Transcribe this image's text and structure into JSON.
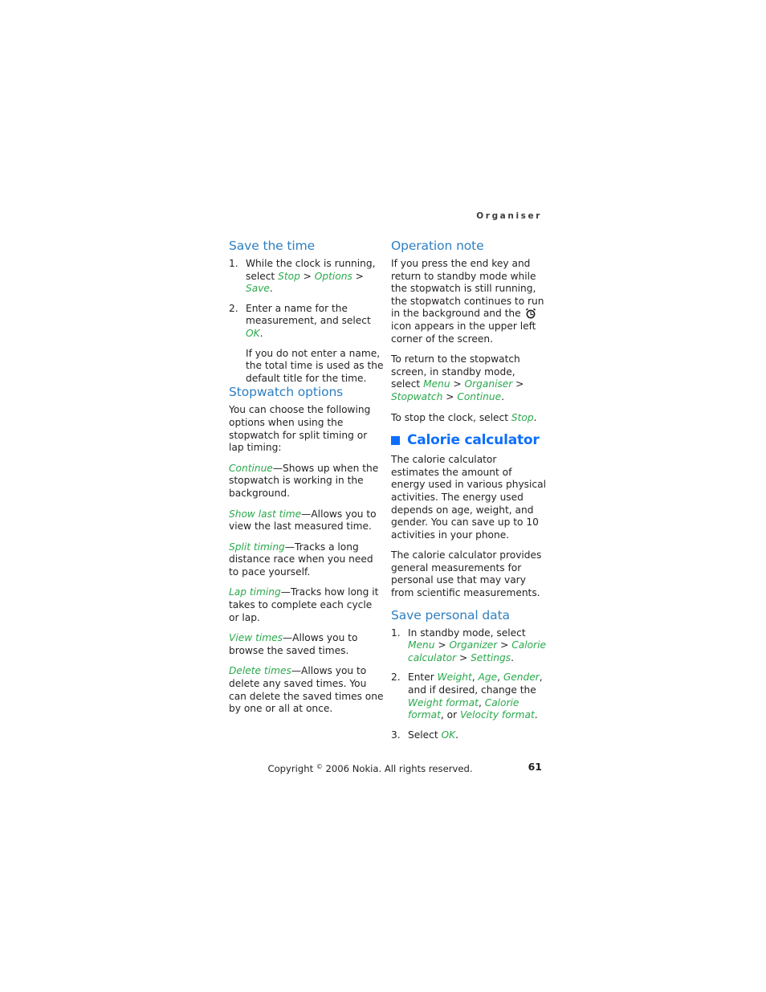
{
  "page": {
    "running_head": "Organiser",
    "number": "61",
    "copyright_prefix": "Copyright ",
    "copyright_symbol": "©",
    "copyright_suffix": " 2006 Nokia. All rights reserved."
  },
  "colors": {
    "heading_blue": "#2e7fc1",
    "major_heading_blue": "#0d6efd",
    "ui_green": "#2aa94c",
    "body_text": "#231f20",
    "running_head": "#3b3b3b"
  },
  "left_column": {
    "section_save_the_time": {
      "heading": "Save the time",
      "steps": [
        {
          "num": "1.",
          "parts": [
            {
              "type": "plain",
              "text": "While the clock is running, select "
            },
            {
              "type": "ui",
              "text": "Stop"
            },
            {
              "type": "sep",
              "text": " > "
            },
            {
              "type": "ui",
              "text": "Options"
            },
            {
              "type": "sep",
              "text": " > "
            },
            {
              "type": "ui",
              "text": "Save"
            },
            {
              "type": "plain",
              "text": "."
            }
          ]
        },
        {
          "num": "2.",
          "parts": [
            {
              "type": "plain",
              "text": "Enter a name for the measurement, and select "
            },
            {
              "type": "ui",
              "text": "OK"
            },
            {
              "type": "plain",
              "text": "."
            }
          ],
          "continuation": "If you do not enter a name, the total time is used as the default title for the time."
        }
      ]
    },
    "section_stopwatch_options": {
      "heading": "Stopwatch options",
      "intro": "You can choose the following options when using the stopwatch for split timing or lap timing:",
      "options": [
        {
          "term": "Continue",
          "desc": "—Shows up when the stopwatch is working in the background."
        },
        {
          "term": "Show last time",
          "desc": "—Allows you to view the last measured time."
        },
        {
          "term": "Split timing",
          "desc": "—Tracks a long distance race when you need to pace yourself."
        },
        {
          "term": "Lap timing",
          "desc": "—Tracks how long it takes to complete each cycle or lap."
        },
        {
          "term": "View times",
          "desc": "—Allows you to browse the saved times."
        },
        {
          "term": "Delete times",
          "desc": "—Allows you to delete any saved times. You can delete the saved times one by one or all at once."
        }
      ]
    }
  },
  "right_column": {
    "section_operation_note": {
      "heading": "Operation note",
      "para1_before_icon": "If you press the end key and return to standby mode while the stopwatch is still running, the stopwatch continues to run in the background and the ",
      "icon_name": "stopwatch-icon",
      "para1_after_icon": " icon appears in the upper left corner of the screen.",
      "para2_parts": [
        {
          "type": "plain",
          "text": "To return to the stopwatch screen, in standby mode, select "
        },
        {
          "type": "ui",
          "text": "Menu"
        },
        {
          "type": "sep",
          "text": " > "
        },
        {
          "type": "ui",
          "text": "Organiser"
        },
        {
          "type": "sep",
          "text": " > "
        },
        {
          "type": "ui",
          "text": "Stopwatch"
        },
        {
          "type": "sep",
          "text": " > "
        },
        {
          "type": "ui",
          "text": "Continue"
        },
        {
          "type": "plain",
          "text": "."
        }
      ],
      "para3_parts": [
        {
          "type": "plain",
          "text": "To stop the clock, select "
        },
        {
          "type": "ui",
          "text": "Stop"
        },
        {
          "type": "plain",
          "text": "."
        }
      ]
    },
    "section_calorie_calculator": {
      "heading": "Calorie calculator",
      "bullet_name": "square-bullet-icon",
      "para1": "The calorie calculator estimates the amount of energy used in various physical activities. The energy used depends on age, weight, and gender. You can save up to 10 activities in your phone.",
      "para2": "The calorie calculator provides general measurements for personal use that may vary from scientific measurements."
    },
    "section_save_personal_data": {
      "heading": "Save personal data",
      "steps": [
        {
          "num": "1.",
          "parts": [
            {
              "type": "plain",
              "text": "In standby mode, select "
            },
            {
              "type": "ui",
              "text": "Menu"
            },
            {
              "type": "sep",
              "text": " > "
            },
            {
              "type": "ui",
              "text": "Organizer"
            },
            {
              "type": "sep",
              "text": " > "
            },
            {
              "type": "ui",
              "text": "Calorie calculator"
            },
            {
              "type": "sep",
              "text": " > "
            },
            {
              "type": "ui",
              "text": "Settings"
            },
            {
              "type": "plain",
              "text": "."
            }
          ]
        },
        {
          "num": "2.",
          "parts": [
            {
              "type": "plain",
              "text": "Enter "
            },
            {
              "type": "ui",
              "text": "Weight"
            },
            {
              "type": "plain",
              "text": ", "
            },
            {
              "type": "ui",
              "text": "Age"
            },
            {
              "type": "plain",
              "text": ", "
            },
            {
              "type": "ui",
              "text": "Gender"
            },
            {
              "type": "plain",
              "text": ", and if desired, change the "
            },
            {
              "type": "ui",
              "text": "Weight format"
            },
            {
              "type": "plain",
              "text": ", "
            },
            {
              "type": "ui",
              "text": "Calorie format"
            },
            {
              "type": "plain",
              "text": ", or "
            },
            {
              "type": "ui",
              "text": "Velocity format"
            },
            {
              "type": "plain",
              "text": "."
            }
          ]
        },
        {
          "num": "3.",
          "parts": [
            {
              "type": "plain",
              "text": "Select "
            },
            {
              "type": "ui",
              "text": "OK"
            },
            {
              "type": "plain",
              "text": "."
            }
          ]
        }
      ]
    }
  }
}
